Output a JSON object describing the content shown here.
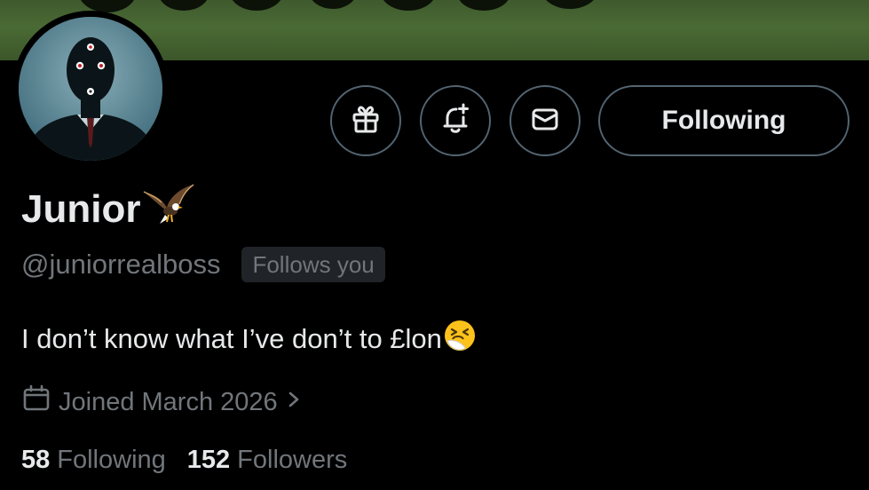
{
  "colors": {
    "banner": "#4a6a34",
    "background": "#000000",
    "text_primary": "#e7e9ea",
    "text_secondary": "#71767b",
    "border": "#536471",
    "badge_bg": "#202327"
  },
  "header": {
    "icons": [
      "gift-icon",
      "bell-plus-icon",
      "envelope-icon"
    ],
    "follow_button_label": "Following"
  },
  "profile": {
    "display_name": "Junior",
    "name_emoji": "eagle-icon",
    "handle": "@juniorrealboss",
    "follows_you_label": "Follows you",
    "bio": "I don’t know what I’ve don’t to £lon",
    "bio_emoji": "sneezing-face-icon",
    "joined": "Joined March 2026",
    "following_count": "58",
    "following_label": "Following",
    "followers_count": "152",
    "followers_label": "Followers"
  }
}
